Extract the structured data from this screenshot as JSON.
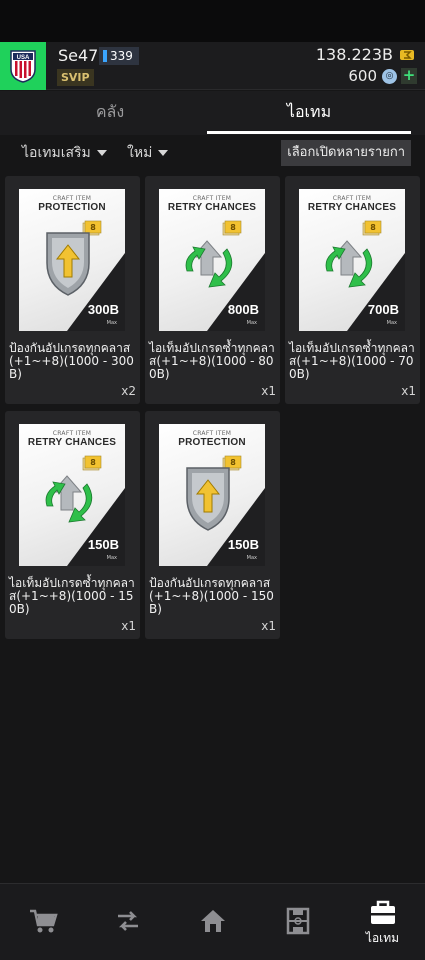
{
  "header": {
    "username": "Se47",
    "level": "339",
    "svip": "SVIP",
    "coins": "138.223B",
    "points": "600",
    "add_symbol": "+"
  },
  "tabs": [
    {
      "label": "คลัง"
    },
    {
      "label": "ไอเทม"
    }
  ],
  "filters": {
    "category": "ไอเทมเสริม",
    "sort": "ใหม่",
    "multi_open": "เลือกเปิดหลายรายกา"
  },
  "items": [
    {
      "craft": "CRAFT ITEM",
      "title": "PROTECTION",
      "value": "300B",
      "max": "Max",
      "name": "ป้องกันอัปเกรดทุกคลาส(+1~+8)(1000 - 300B)",
      "qty": "x2",
      "tier": "8",
      "art": "shield"
    },
    {
      "craft": "CRAFT ITEM",
      "title": "RETRY CHANCES",
      "value": "800B",
      "max": "Max",
      "name": "ไอเท็มอัปเกรดซ้ำทุกคลาส(+1~+8)(1000 - 800B)",
      "qty": "x1",
      "tier": "8",
      "art": "retry"
    },
    {
      "craft": "CRAFT ITEM",
      "title": "RETRY CHANCES",
      "value": "700B",
      "max": "Max",
      "name": "ไอเท็มอัปเกรดซ้ำทุกคลาส(+1~+8)(1000 - 700B)",
      "qty": "x1",
      "tier": "8",
      "art": "retry"
    },
    {
      "craft": "CRAFT ITEM",
      "title": "RETRY CHANCES",
      "value": "150B",
      "max": "Max",
      "name": "ไอเท็มอัปเกรดซ้ำทุกคลาส(+1~+8)(1000 - 150B)",
      "qty": "x1",
      "tier": "8",
      "art": "retry"
    },
    {
      "craft": "CRAFT ITEM",
      "title": "PROTECTION",
      "value": "150B",
      "max": "Max",
      "name": "ป้องกันอัปเกรดทุกคลาส(+1~+8)(1000 - 150B)",
      "qty": "x1",
      "tier": "8",
      "art": "shield"
    }
  ],
  "bottom_nav": [
    {
      "icon": "cart-icon",
      "label": ""
    },
    {
      "icon": "transfer-icon",
      "label": ""
    },
    {
      "icon": "home-icon",
      "label": ""
    },
    {
      "icon": "squad-field-icon",
      "label": ""
    },
    {
      "icon": "bag-icon",
      "label": "ไอเทม"
    }
  ],
  "colors": {
    "accent_green": "#1fd15b",
    "background": "#161617",
    "card_dark": "#1f1f21"
  }
}
